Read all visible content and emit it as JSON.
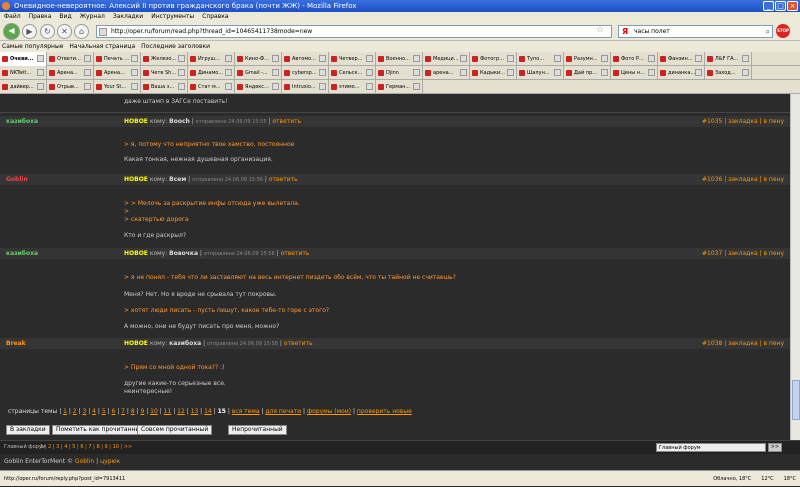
{
  "window": {
    "title": "Очевидное-невероятное: Алексий II против гражданского брака (почти ЖЖ) - Mozilla Firefox"
  },
  "menu": [
    "Файл",
    "Правка",
    "Вид",
    "Журнал",
    "Закладки",
    "Инструменты",
    "Справка"
  ],
  "navbar": {
    "url": "http://oper.ru/forum/read.php?thread_id=10465411738mode=new",
    "search": "часы полет"
  },
  "bookmarks": [
    "Самые популярные",
    "Начальная страница",
    "Последние заголовки"
  ],
  "tabs_row1": [
    "Очеви...",
    "Ответи...",
    "Печать ...",
    "Железо...",
    "Игруш...",
    "Кино-Ф...",
    "Автомо...",
    "Четвер...",
    "Военно...",
    "Медици...",
    "Фотогр...",
    "Тупо...",
    "Разумн...",
    "Фото Р...",
    "Фанзин...",
    "Л&F ГА..."
  ],
  "tabs_row2": [
    "NKTwit...",
    "Арена...",
    "Арена...",
    "Четв Sh...",
    "Динамо...",
    "Gmail -...",
    "cybersp...",
    "Сельск...",
    "Djinn",
    "арена...",
    "Кадыки...",
    "Шалун...",
    "Дай пр...",
    "Цены н...",
    "динанка...",
    "Заход..."
  ],
  "tabs_row3": [
    "дайвер...",
    "Отрыв...",
    "Your St...",
    "Ваша з...",
    "Стат м...",
    "Яндекс...",
    "Intrusio...",
    "этимо...",
    "Герман..."
  ],
  "content": {
    "prev_tail": "даже штамп в ЗАГСе поставить!",
    "posts": [
      {
        "author": "казибоха",
        "author_color": "#6c6",
        "new": "НОВОЕ",
        "to_label": "кому:",
        "to": "Booch",
        "date": "отправлено 24.06.09 15:55",
        "reply": "ответить",
        "num": "#1035",
        "bookmark": "закладка",
        "up": "в пену",
        "lines": [
          {
            "k": "q",
            "text": "> я, потому что неприятно твое хамство, постоянное"
          },
          {
            "k": "t",
            "text": "Какая тонкая, нежная душевная организация."
          }
        ]
      },
      {
        "author": "Goblin",
        "author_color": "#e44",
        "new": "НОВОЕ",
        "to_label": "кому:",
        "to": "Всем",
        "date": "отправлено 24.06.09 15:56",
        "reply": "ответить",
        "num": "#1036",
        "bookmark": "закладка",
        "up": "в пену",
        "lines": [
          {
            "k": "q",
            "text": "> > Мелочь за раскрытие инфы отсюда уже вылетала."
          },
          {
            "k": "q",
            "text": ">"
          },
          {
            "k": "q",
            "text": "> скатертью дорога"
          },
          {
            "k": "t",
            "text": "Кто и где раскрыл?"
          }
        ]
      },
      {
        "author": "казибоха",
        "author_color": "#6c6",
        "new": "НОВОЕ",
        "to_label": "кому:",
        "to": "Вовочка",
        "date": "отправлено 24.06.09 15:58",
        "reply": "ответить",
        "num": "#1037",
        "bookmark": "закладка",
        "up": "в пену",
        "lines": [
          {
            "k": "q",
            "text": "> я не понял - тебя что ли заставляют на весь интернет пиздеть обо всём, что ты тайной не считаешь?"
          },
          {
            "k": "t",
            "text": "Меня? Нет. Но я вроде не срывала тут покровы."
          },
          {
            "k": "q",
            "text": "> хотят люди писать - пусть пишут, какое тебе-то горе с этого?"
          },
          {
            "k": "t",
            "text": "А можно, они не будут писать про меня, можно?"
          }
        ]
      },
      {
        "author": "Break",
        "author_color": "#f90",
        "new": "НОВОЕ",
        "to_label": "кому:",
        "to": "казибоха",
        "date": "отправлено 24.06.09 15:58",
        "reply": "ответить",
        "num": "#1038",
        "bookmark": "закладка",
        "up": "в пену",
        "lines": [
          {
            "k": "q",
            "text": "> Прям со мной одной тока?? :)"
          },
          {
            "k": "t",
            "text": "другие какие-то серьезные все."
          },
          {
            "k": "t",
            "text": "неинтересные!"
          }
        ]
      }
    ],
    "pager": {
      "label": "страницы темы",
      "pages": [
        "1",
        "2",
        "3",
        "4",
        "5",
        "6",
        "7",
        "8",
        "9",
        "10",
        "11",
        "12",
        "13",
        "14",
        "15"
      ],
      "links": [
        "вся тема",
        "для печати",
        "форумы (мои)",
        "проверить новые"
      ]
    },
    "buttons": [
      "В закладки",
      "Пометить как прочитанный",
      "Совсем прочитанный",
      "Непрочитанный"
    ]
  },
  "subfooter": {
    "label": "Главный форум",
    "pages": [
      "1",
      "2",
      "3",
      "4",
      "5",
      "6",
      "7",
      "8",
      "9",
      "10",
      ">>"
    ],
    "select": "Главный форум",
    "go": ">>"
  },
  "credits": {
    "text": "Goblin EnterTorMent ©",
    "name": "Goblin",
    "sep": "|",
    "link": "цурюк"
  },
  "status": {
    "link": "http://oper.ru/forum/reply.php?post_id=7913411",
    "weather1": "Облачно, 18°C",
    "temp": "12°C",
    "weather2": "18°C"
  }
}
